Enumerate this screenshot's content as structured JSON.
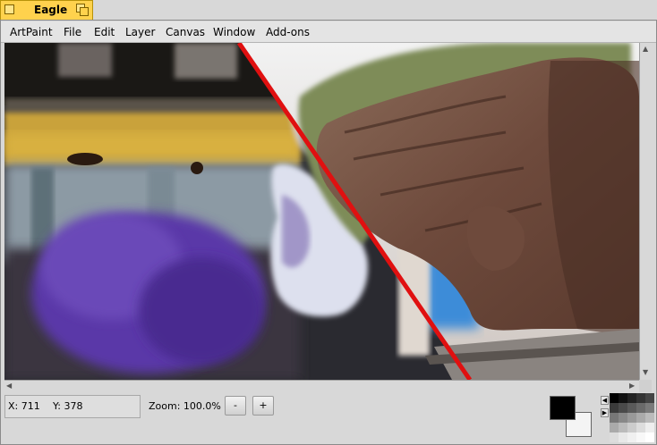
{
  "window": {
    "title": "Eagle"
  },
  "menu": [
    "ArtPaint",
    "File",
    "Edit",
    "Layer",
    "Canvas",
    "Window",
    "Add-ons"
  ],
  "status": {
    "x_label": "X: 711",
    "y_label": "Y: 378",
    "zoom_label": "Zoom: 100.0%",
    "zoom_out": "-",
    "zoom_in": "+"
  },
  "colors": {
    "foreground": "#000000",
    "background": "#f4f4f4",
    "divider_line": "#e01010",
    "title_tab": "#ffd24d"
  },
  "icons": {
    "close": "close-box-icon",
    "zoom": "zoom-box-icon",
    "scroll_up": "arrow-up-icon",
    "scroll_down": "arrow-down-icon",
    "scroll_left": "arrow-left-icon",
    "scroll_right": "arrow-right-icon",
    "palette_prev": "arrow-left-icon",
    "palette_next": "arrow-right-icon"
  }
}
